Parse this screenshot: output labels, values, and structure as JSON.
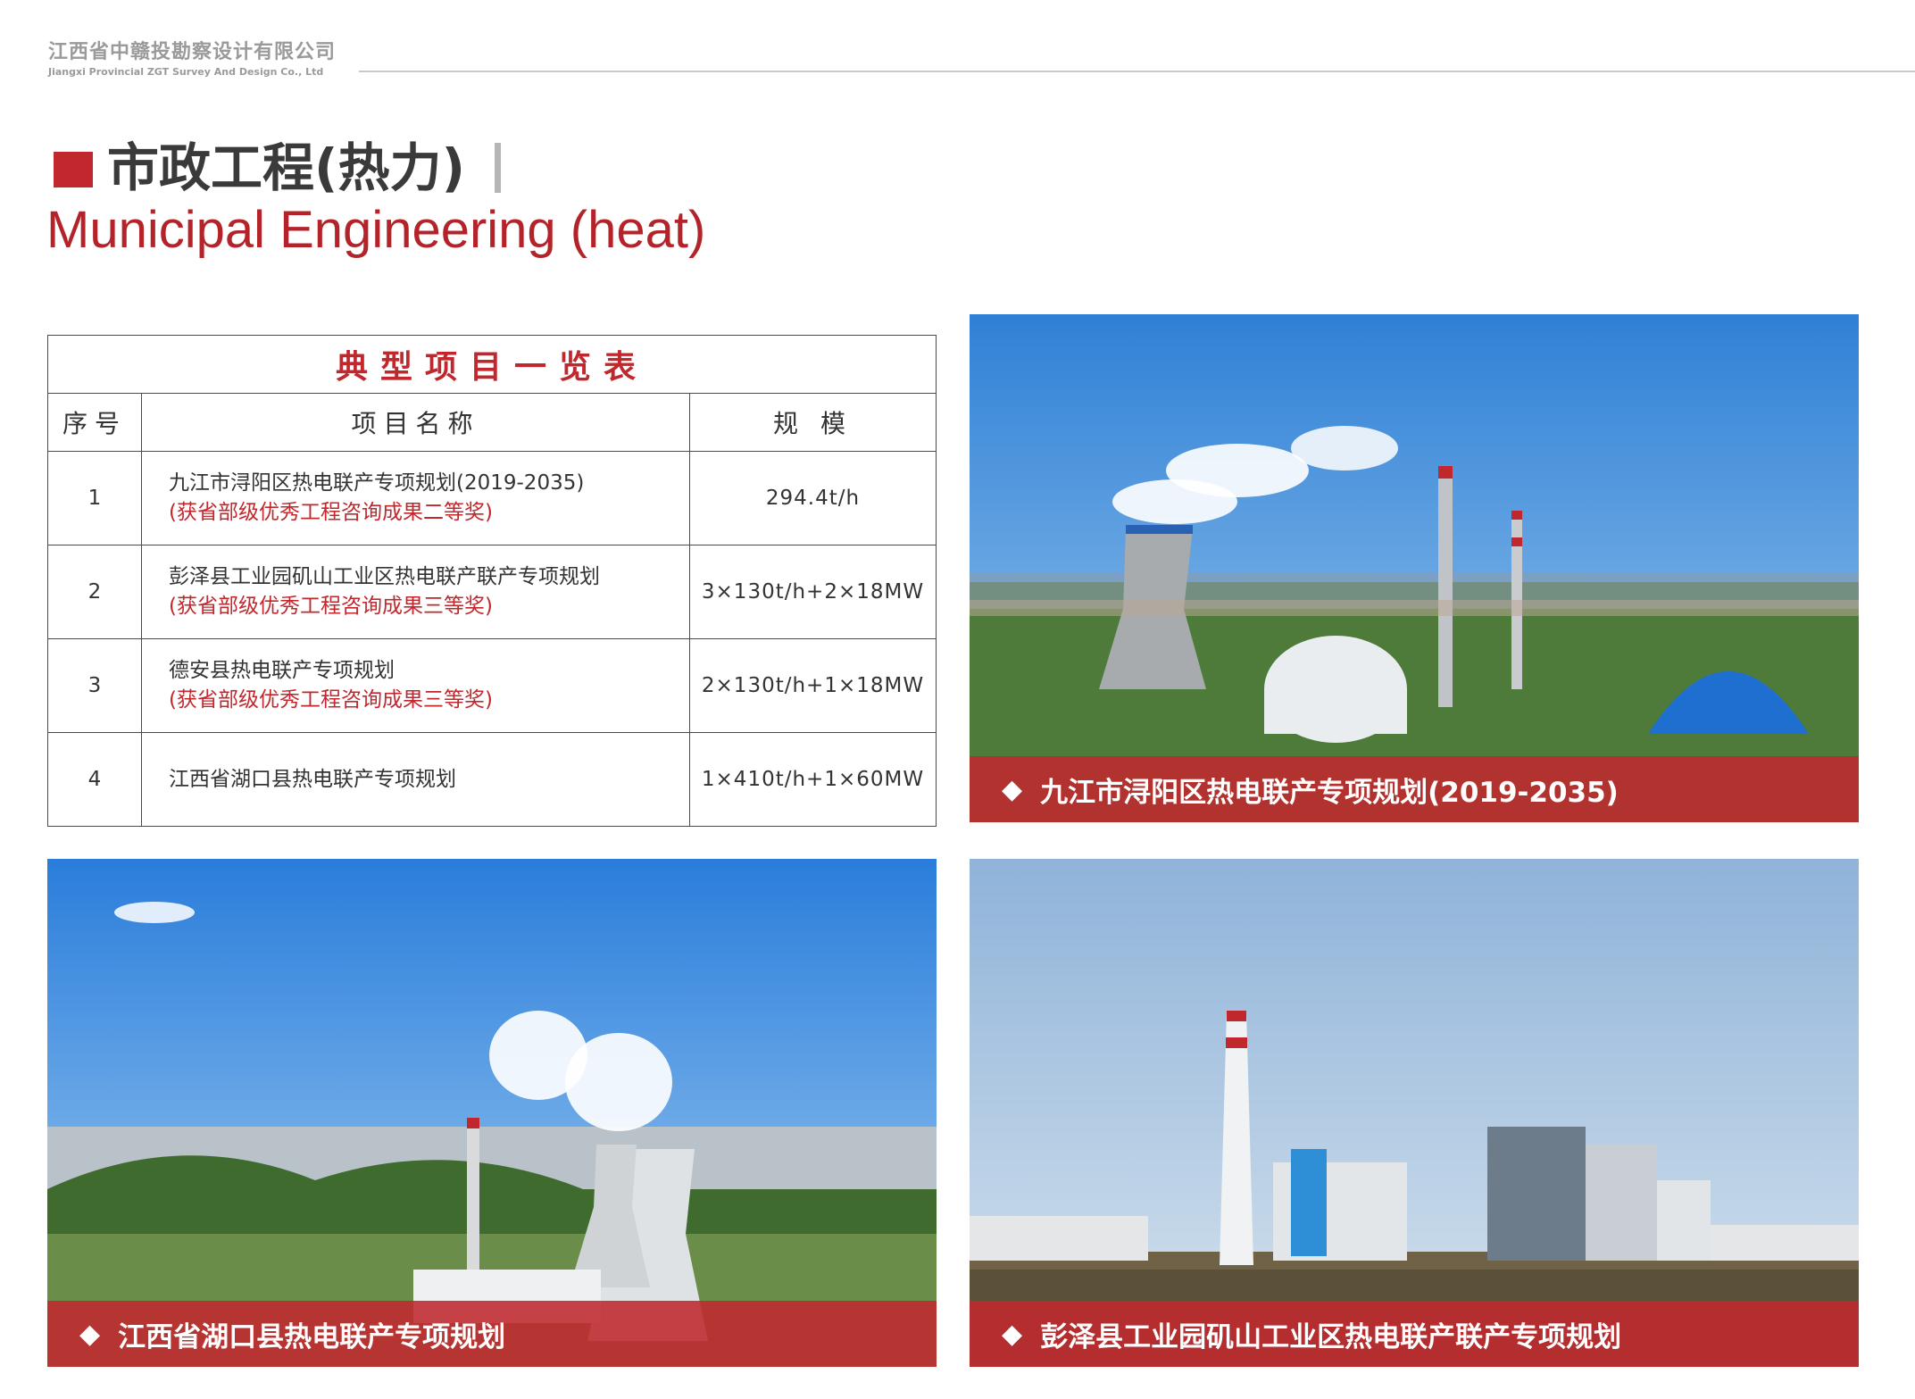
{
  "company": {
    "name_cn": "江西省中赣投勘察设计有限公司",
    "name_en": "Jiangxi Provincial ZGT Survey And Design Co., Ltd"
  },
  "title": {
    "cn": "市政工程(热力)",
    "en": "Municipal Engineering (heat)"
  },
  "table": {
    "title": "典型项目一览表",
    "headers": {
      "seq": "序号",
      "name": "项目名称",
      "scale": "规 模"
    },
    "rows": [
      {
        "seq": "1",
        "name": "九江市浔阳区热电联产专项规划(2019-2035)",
        "award": "(获省部级优秀工程咨询成果二等奖)",
        "scale": "294.4t/h"
      },
      {
        "seq": "2",
        "name": "彭泽县工业园矶山工业区热电联产联产专项规划",
        "award": "(获省部级优秀工程咨询成果三等奖)",
        "scale": "3×130t/h+2×18MW"
      },
      {
        "seq": "3",
        "name": "德安县热电联产专项规划",
        "award": "(获省部级优秀工程咨询成果三等奖)",
        "scale": "2×130t/h+1×18MW"
      },
      {
        "seq": "4",
        "name": "江西省湖口县热电联产专项规划",
        "award": "",
        "scale": "1×410t/h+1×60MW"
      }
    ]
  },
  "photos": {
    "p1": {
      "caption": "九江市浔阳区热电联产专项规划(2019-2035)"
    },
    "p2": {
      "caption": "江西省湖口县热电联产专项规划"
    },
    "p3": {
      "caption": "彭泽县工业园矶山工业区热电联产联产专项规划"
    }
  },
  "icons": {
    "caption_marker": "diamond-icon"
  },
  "colors": {
    "accent": "#c0282e",
    "title_gray": "#3a3a3a",
    "muted": "#9a9a9a"
  }
}
